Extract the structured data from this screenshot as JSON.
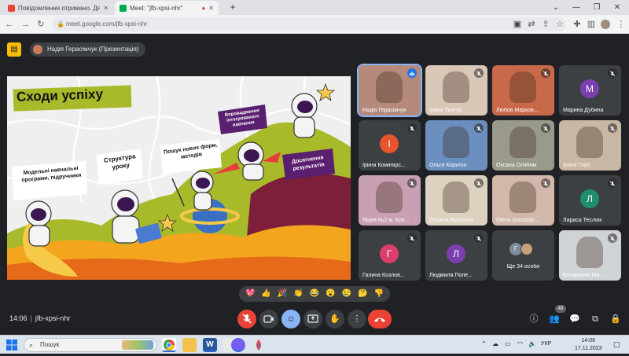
{
  "browser": {
    "tabs": [
      {
        "title": "Повідомлення отримано. Дяку",
        "active": false
      },
      {
        "title": "Meet: \"jfb-xpsi-nhr\"",
        "active": true
      }
    ],
    "new_tab": "+",
    "url": "meet.google.com/jfb-xpsi-nhr"
  },
  "meet": {
    "presenter": "Надія Герасімчук (Презентація)",
    "meeting_code": "jfb-xpsi-nhr",
    "time": "14:06",
    "people_count": "49",
    "slide": {
      "title": "Сходи успіху",
      "labels": [
        "Модельні навчальні програми, підручники",
        "Структура уроку",
        "Пошук нових форм, методів",
        "Впровадження інтегрованого навчання",
        "Досягнення результатів"
      ]
    },
    "participants": [
      {
        "name": "Надія Герасімчук",
        "kind": "photo",
        "color": "#b58a7a",
        "speaking": true
      },
      {
        "name": "Ірина Тригуб",
        "kind": "photo",
        "color": "#d9c7b8"
      },
      {
        "name": "Любов Марков...",
        "kind": "photo",
        "color": "#c86a4a"
      },
      {
        "name": "Марина Дубина",
        "kind": "letter",
        "letter": "М",
        "color": "#7b3fb0"
      },
      {
        "name": "Ірина Комінярс...",
        "kind": "letter",
        "letter": "І",
        "color": "#e8542e"
      },
      {
        "name": "Ольга Коритко",
        "kind": "photo",
        "color": "#6b8fbf"
      },
      {
        "name": "Оксана Олійник",
        "kind": "photo",
        "color": "#9a9a8a"
      },
      {
        "name": "Ірина Глуб",
        "kind": "photo",
        "color": "#c7b7a3"
      },
      {
        "name": "Ліцей №2 м. Коп...",
        "kind": "photo",
        "color": "#c9a0b3"
      },
      {
        "name": "Oksana Riabinina",
        "kind": "photo",
        "color": "#ddd2c0"
      },
      {
        "name": "Olena Gorodski...",
        "kind": "photo",
        "color": "#d2b8aa"
      },
      {
        "name": "Лариса Теслюк",
        "kind": "letter",
        "letter": "Л",
        "color": "#1e8e6e"
      },
      {
        "name": "Галина Козлов...",
        "kind": "letter",
        "letter": "Г",
        "color": "#d93f6a"
      },
      {
        "name": "Людмила Поле...",
        "kind": "letter",
        "letter": "Л",
        "color": "#7b3fb0"
      },
      {
        "name": "Ще 34 особи",
        "kind": "others",
        "letter": "Г",
        "color": "#7a8c9e"
      },
      {
        "name": "Кондирєва Ма...",
        "kind": "photo",
        "color": "#cfd3d6"
      }
    ],
    "reactions": [
      "💖",
      "👍",
      "🎉",
      "👏",
      "😂",
      "😮",
      "😢",
      "🤔",
      "👎"
    ]
  },
  "taskbar": {
    "search_placeholder": "Пошук",
    "lang": "УКР",
    "clock_time": "14:06",
    "clock_date": "17.11.2023"
  },
  "colors": {
    "accent": "#8ab4f8",
    "danger": "#ea4335",
    "surface": "#3c4043",
    "slide_olive": "#a8ba2a",
    "slide_purple": "#5a1f6e"
  }
}
